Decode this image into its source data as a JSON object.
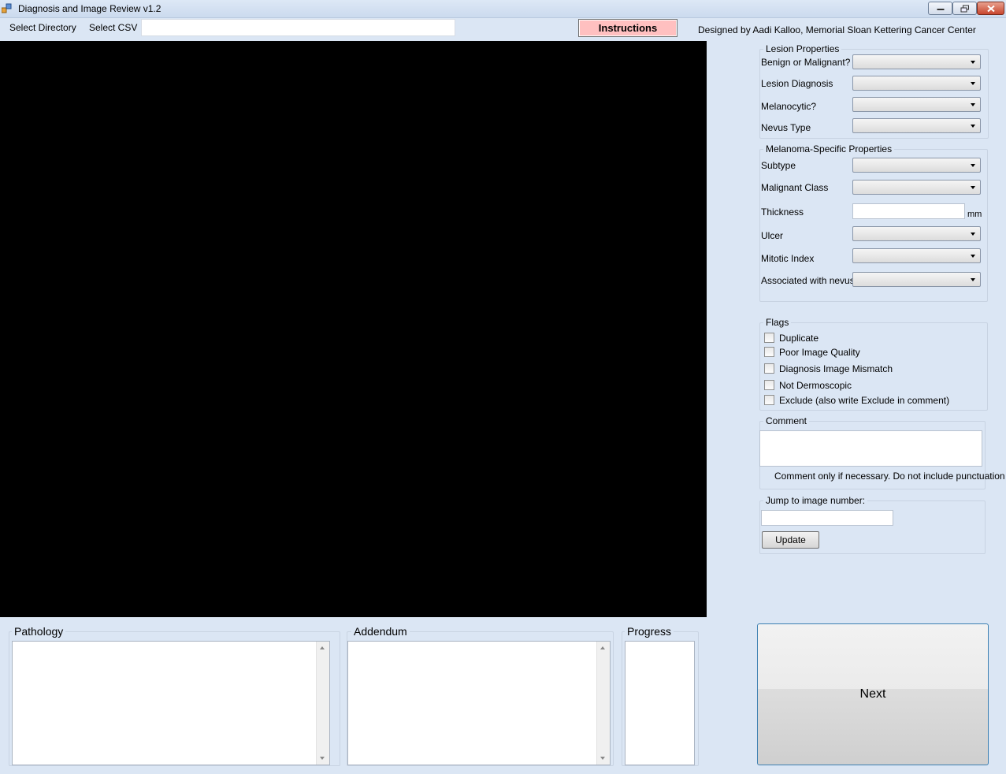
{
  "window": {
    "title": "Diagnosis and Image Review v1.2",
    "icons": [
      "app-icon",
      "minimize-icon",
      "restore-icon",
      "close-icon"
    ]
  },
  "menu": {
    "select_directory": "Select Directory",
    "select_csv": "Select CSV",
    "path_value": "",
    "instructions_label": "Instructions",
    "credit": "Designed by Aadi Kalloo, Memorial Sloan Kettering Cancer Center"
  },
  "lesion_properties": {
    "title": "Lesion Properties",
    "fields": [
      {
        "label": "Benign or Malignant?",
        "value": ""
      },
      {
        "label": "Lesion Diagnosis",
        "value": ""
      },
      {
        "label": "Melanocytic?",
        "value": ""
      },
      {
        "label": "Nevus Type",
        "value": ""
      }
    ]
  },
  "melanoma_properties": {
    "title": "Melanoma-Specific Properties",
    "subtype": {
      "label": "Subtype",
      "value": ""
    },
    "malignant_class": {
      "label": "Malignant Class",
      "value": ""
    },
    "thickness": {
      "label": "Thickness",
      "value": "",
      "unit": "mm"
    },
    "ulcer": {
      "label": "Ulcer",
      "value": ""
    },
    "mitotic_index": {
      "label": "Mitotic Index",
      "value": ""
    },
    "associated_with_nevus": {
      "label": "Associated with nevus",
      "value": ""
    }
  },
  "flags": {
    "title": "Flags",
    "items": [
      {
        "label": "Duplicate",
        "checked": false
      },
      {
        "label": "Poor Image Quality",
        "checked": false
      },
      {
        "label": "Diagnosis Image Mismatch",
        "checked": false
      },
      {
        "label": "Not Dermoscopic",
        "checked": false
      },
      {
        "label": "Exclude (also write Exclude in comment)",
        "checked": false
      }
    ]
  },
  "comment": {
    "title": "Comment",
    "value": "",
    "hint": "Comment only if necessary. Do not include punctuation"
  },
  "jump": {
    "title": "Jump to image number:",
    "value": "",
    "update_label": "Update"
  },
  "bottom": {
    "pathology_title": "Pathology",
    "pathology_text": "",
    "addendum_title": "Addendum",
    "addendum_text": "",
    "progress_title": "Progress",
    "progress_text": ""
  },
  "next_label": "Next",
  "colors": {
    "background": "#dbe6f4",
    "instructions_button": "#ffc0c0",
    "image_canvas": "#000000",
    "next_border": "#3c7fb1"
  }
}
